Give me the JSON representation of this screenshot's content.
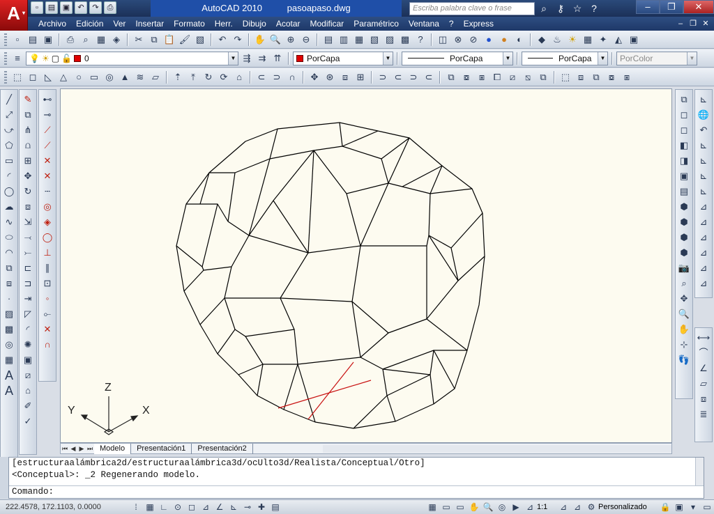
{
  "app": {
    "name": "AutoCAD 2010",
    "file": "pasoapaso.dwg",
    "search_placeholder": "Escriba palabra clave o frase"
  },
  "menu": [
    "Archivo",
    "Edición",
    "Ver",
    "Insertar",
    "Formato",
    "Herr.",
    "Dibujo",
    "Acotar",
    "Modificar",
    "Paramétrico",
    "Ventana",
    "?",
    "Express"
  ],
  "layers": {
    "current_layer": "0",
    "color": "PorCapa",
    "linetype": "PorCapa",
    "lineweight": "PorCapa",
    "plotstyle": "PorColor",
    "layer_color": "#e00000"
  },
  "ucs": {
    "x": "X",
    "y": "Y",
    "z": "Z"
  },
  "tabs": [
    "Modelo",
    "Presentación1",
    "Presentación2"
  ],
  "command": {
    "history": [
      "[estructuraalámbrica2d/estructuraalámbrica3d/ocUlto3d/Realista/Conceptual/Otro]",
      "<Conceptual>: _2 Regenerando modelo."
    ],
    "prompt": "Comando:"
  },
  "status": {
    "coordinates": "222.4578, 172.1103, 0.0000",
    "scale": "1:1",
    "workspace": "Personalizado"
  }
}
